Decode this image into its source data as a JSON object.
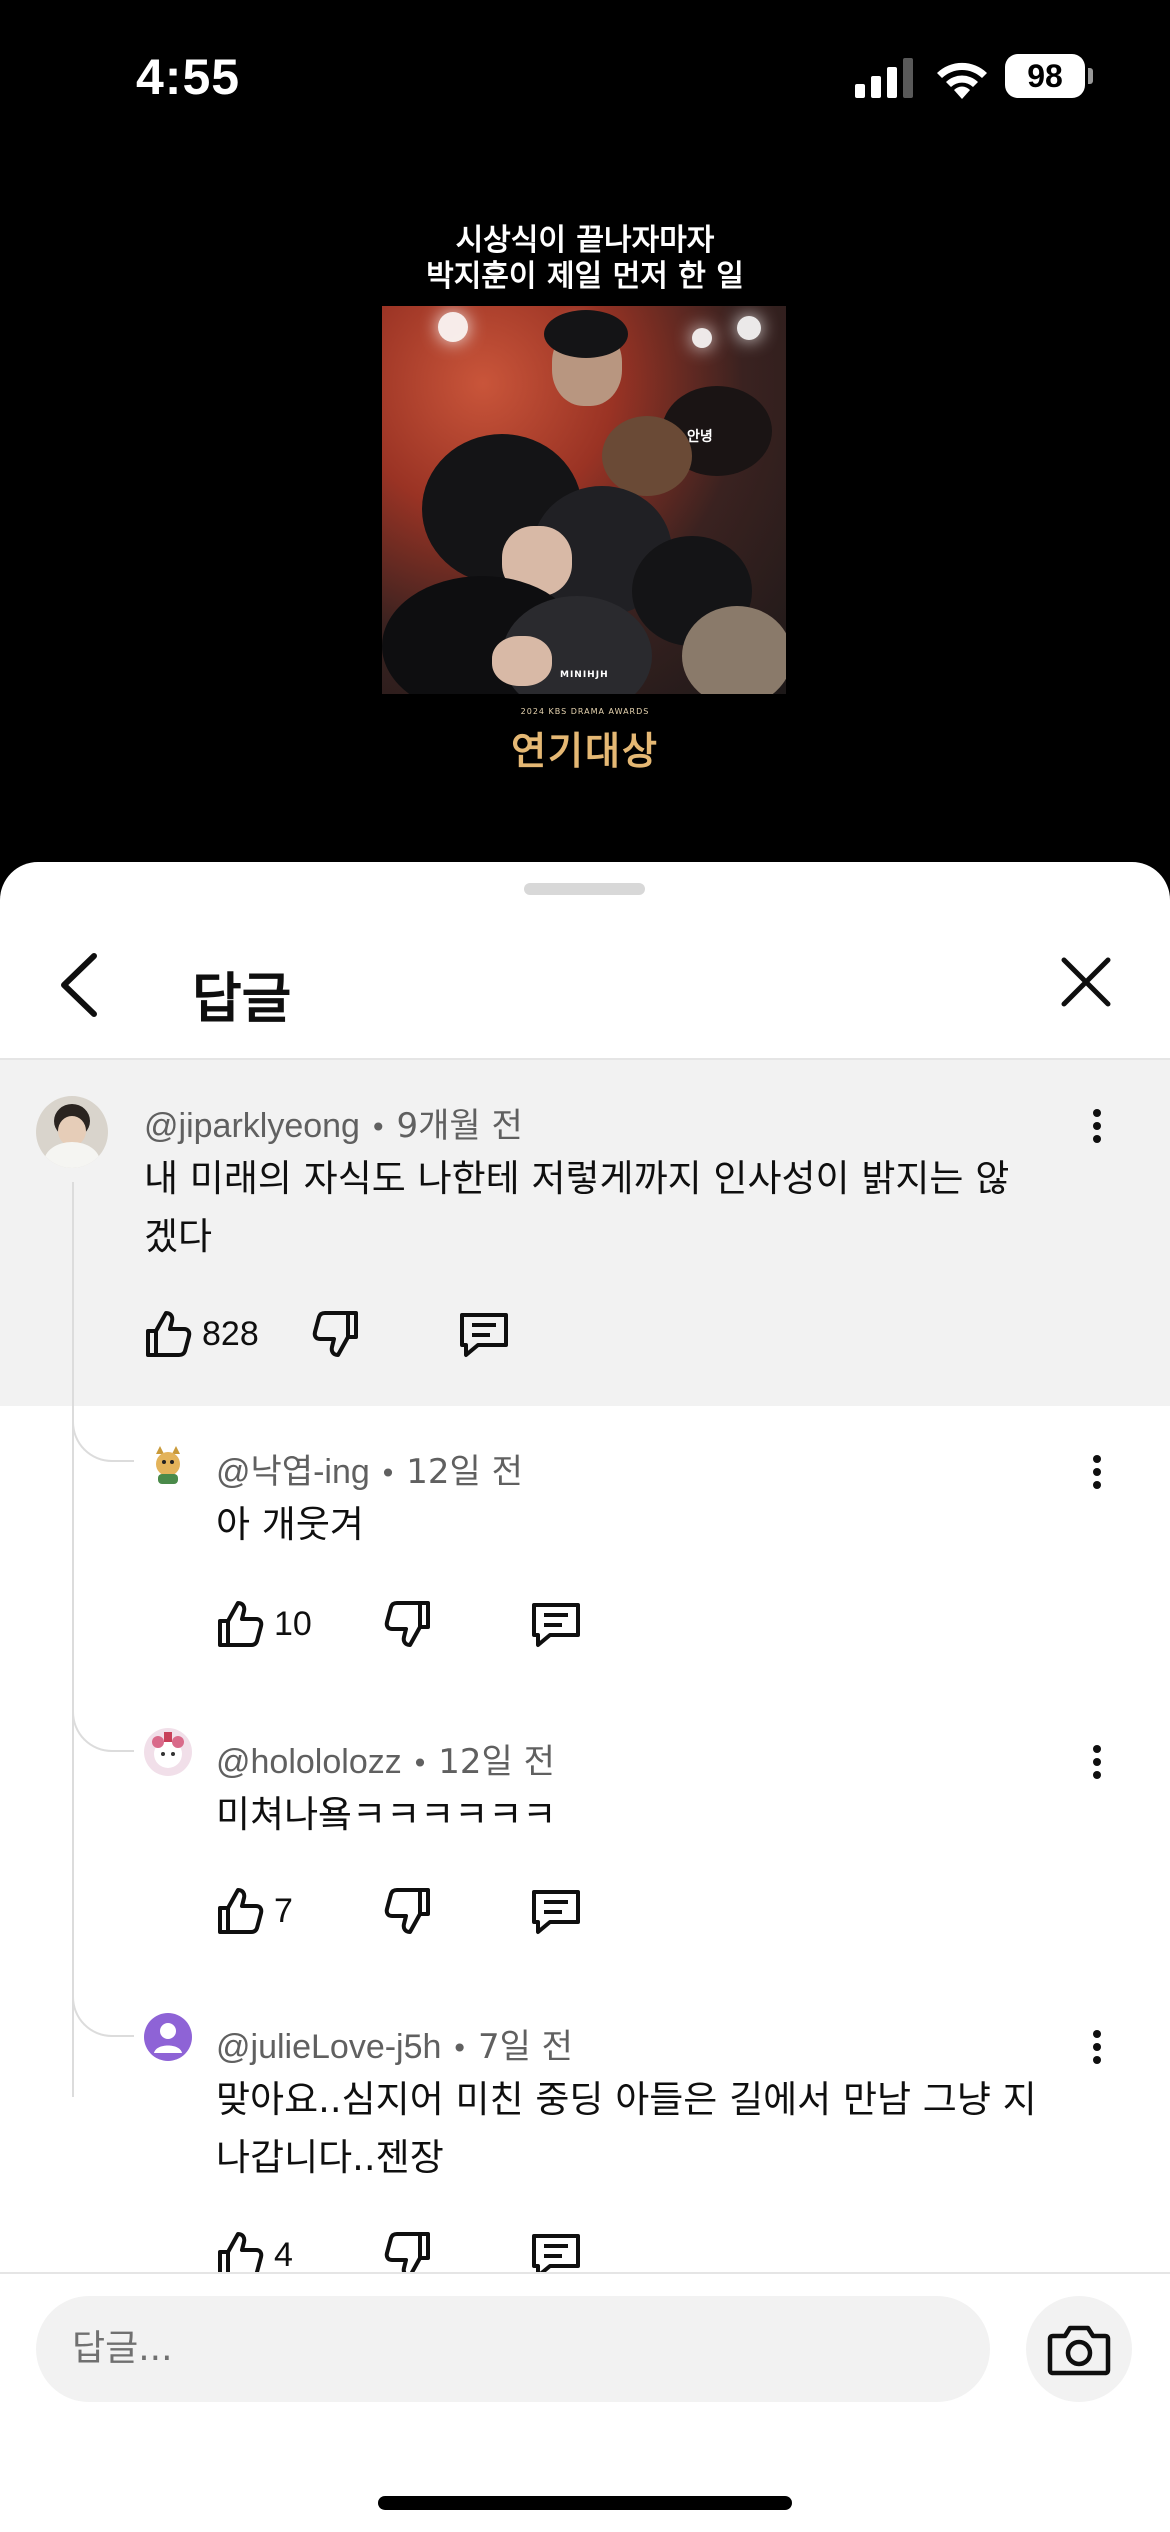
{
  "status": {
    "time": "4:55",
    "battery": "98"
  },
  "video": {
    "caption_line1": "시상식이 끝나자마자",
    "caption_line2": "박지훈이 제일 먼저 한 일",
    "bubble": "안녕",
    "watermark": "MINIHJH",
    "award_sub": "2024 KBS DRAMA AWARDS",
    "award_title": "연기대상"
  },
  "sheet": {
    "title": "답글"
  },
  "comments": [
    {
      "author": "@jiparklyeong",
      "time": "9개월 전",
      "text_line1": "내 미래의 자식도 나한테 저렇게까지 인사성이 밝지는 않",
      "text_line2": "겠다",
      "likes": "828"
    },
    {
      "author": "@낙엽-ing",
      "time": "12일 전",
      "text_line1": "아 개웃겨",
      "likes": "10"
    },
    {
      "author": "@holololozz",
      "time": "12일 전",
      "text_line1": "미쳐나욬ㅋㅋㅋㅋㅋㅋ",
      "likes": "7"
    },
    {
      "author": "@julieLove-j5h",
      "time": "7일 전",
      "text_line1": "맞아요..심지어 미친 중딩 아들은 길에서 만남 그냥 지",
      "text_line2": "나갑니다..젠장",
      "likes": "4"
    }
  ],
  "composer": {
    "placeholder": "답글..."
  },
  "colors": {
    "avatar_purple": "#8e63d6",
    "sheet_bg": "#ffffff",
    "highlight_bg": "#f2f2f2"
  }
}
